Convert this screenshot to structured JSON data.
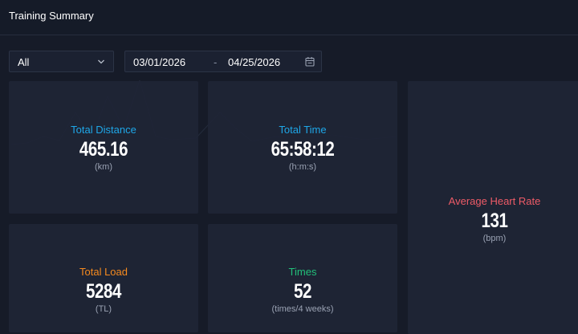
{
  "header": {
    "title": "Training Summary"
  },
  "filters": {
    "sport_value": "All",
    "date_start": "03/01/2026",
    "date_separator": "-",
    "date_end": "04/25/2026"
  },
  "metrics": [
    {
      "label": "Total Distance",
      "value": "465.16",
      "unit": "(km)",
      "color": "#1ea7e8"
    },
    {
      "label": "Total Time",
      "value": "65:58:12",
      "unit": "(h:m:s)",
      "color": "#1ea7e8"
    },
    {
      "label": "Average Heart Rate",
      "value": "131",
      "unit": "(bpm)",
      "color": "#ee5b67"
    },
    {
      "label": "Total Load",
      "value": "5284",
      "unit": "(TL)",
      "color": "#f68a1e"
    },
    {
      "label": "Times",
      "value": "52",
      "unit": "(times/4 weeks)",
      "color": "#22c07a"
    }
  ],
  "colors": {
    "background": "#161b28",
    "card": "#1f2536",
    "border": "#2c3446"
  },
  "icons": {
    "dropdown": "chevron-down-icon",
    "calendar": "calendar-icon"
  }
}
